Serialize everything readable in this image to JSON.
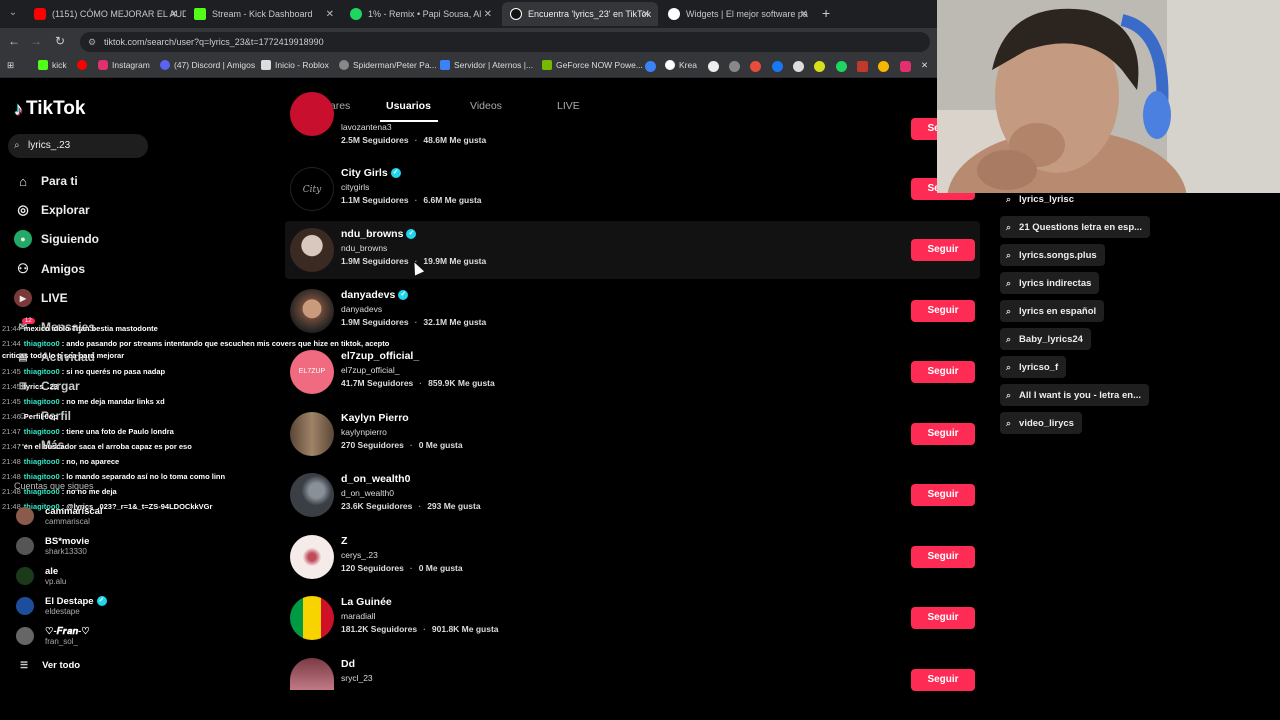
{
  "browser": {
    "tabs": [
      {
        "title": "(1151) CÓMO MEJORAR EL AUD",
        "favicon_color": "#ff0000"
      },
      {
        "title": "Stream - Kick Dashboard",
        "favicon_color": "#53fc18"
      },
      {
        "title": "1% - Remix • Papi Sousa, Al",
        "favicon_color": "#1ed760"
      },
      {
        "title": "Encuentra 'lyrics_23' en TikTok",
        "favicon_color": "#ffffff"
      },
      {
        "title": "Widgets | El mejor software pa",
        "favicon_color": "#ffffff"
      }
    ],
    "url": "tiktok.com/search/user?q=lyrics_23&t=1772419918990",
    "bookmarks": [
      {
        "label": "kick",
        "color": "#53fc18"
      },
      {
        "label": "Instagram",
        "color": "#e1306c"
      },
      {
        "label": "(47) Discord | Amigos",
        "color": "#5865f2"
      },
      {
        "label": "Inicio - Roblox",
        "color": "#dddddd"
      },
      {
        "label": "Spiderman/Peter Pa...",
        "color": "#888888"
      },
      {
        "label": "Servidor | Aternos |...",
        "color": "#3b82f6"
      },
      {
        "label": "GeForce NOW Powe...",
        "color": "#76b900"
      },
      {
        "label": "Krea",
        "color": "#ffffff"
      }
    ]
  },
  "tiktok": {
    "logo_text": "TikTok",
    "search_value": "lyrics_.23",
    "nav": [
      {
        "label": "Para ti",
        "icon": "home-icon"
      },
      {
        "label": "Explorar",
        "icon": "compass-icon"
      },
      {
        "label": "Siguiendo",
        "icon": "following-icon"
      },
      {
        "label": "Amigos",
        "icon": "friends-icon"
      },
      {
        "label": "LIVE",
        "icon": "live-icon"
      }
    ],
    "overlay_nav": [
      "Mensajes",
      "Actividad",
      "Cargar",
      "Perfil",
      "Más"
    ],
    "messages_badge": "12",
    "following_label": "Cuentas que sigues",
    "following_accounts": [
      {
        "name": "cammariscal",
        "handle": "cammariscal",
        "color": "#8a5a4a",
        "verified": false
      },
      {
        "name": "BS*movie",
        "handle": "shark13330",
        "color": "#555555",
        "verified": false
      },
      {
        "name": "ale",
        "handle": "vp.alu",
        "color": "#1a3a1a",
        "verified": false
      },
      {
        "name": "El Destape",
        "handle": "eldestape",
        "color": "#1d4e9c",
        "verified": true
      },
      {
        "name": "♡-𝑭𝒓𝒂𝒏-♡",
        "handle": "fran_sol_",
        "color": "#666666",
        "verified": false
      }
    ],
    "see_all": "Ver todo",
    "result_tabs": [
      "Populares",
      "Usuarios",
      "Videos",
      "LIVE"
    ],
    "active_tab": "Usuarios",
    "follow_label": "Seguir",
    "users": [
      {
        "name": "",
        "handle": "lavozantena3",
        "followers": "2.5M Seguidores",
        "likes": "48.6M Me gusta",
        "verified": false,
        "color": "#c8102e"
      },
      {
        "name": "City Girls",
        "handle": "citygirls",
        "followers": "1.1M Seguidores",
        "likes": "6.6M Me gusta",
        "verified": true,
        "color": "#000000"
      },
      {
        "name": "ndu_browns",
        "handle": "ndu_browns",
        "followers": "1.9M Seguidores",
        "likes": "19.9M Me gusta",
        "verified": true,
        "color": "#3b2a22"
      },
      {
        "name": "danyadevs",
        "handle": "danyadevs",
        "followers": "1.9M Seguidores",
        "likes": "32.1M Me gusta",
        "verified": true,
        "color": "#6d4a3a"
      },
      {
        "name": "el7zup_official_",
        "handle": "el7zup_official_",
        "followers": "41.7M Seguidores",
        "likes": "859.9K Me gusta",
        "verified": false,
        "color": "#f06a80"
      },
      {
        "name": "Kaylyn Pierro",
        "handle": "kaylynpierro",
        "followers": "270 Seguidores",
        "likes": "0 Me gusta",
        "verified": false,
        "color": "#7a6650"
      },
      {
        "name": "d_on_wealth0",
        "handle": "d_on_wealth0",
        "followers": "23.6K Seguidores",
        "likes": "293 Me gusta",
        "verified": false,
        "color": "#3a3f46"
      },
      {
        "name": "Z",
        "handle": "cerys_.23",
        "followers": "120 Seguidores",
        "likes": "0 Me gusta",
        "verified": false,
        "color": "#e8d4d0"
      },
      {
        "name": "La Guinée",
        "handle": "maradiall",
        "followers": "181.2K Seguidores",
        "likes": "901.8K Me gusta",
        "verified": false,
        "color": "#f7d400"
      },
      {
        "name": "Dd",
        "handle": "srycl_23",
        "followers": "",
        "likes": "",
        "verified": false,
        "color": "#7a3a45"
      }
    ],
    "suggestions": [
      "lyrics_lyrisc",
      "21 Questions letra en esp...",
      "lyrics.songs.plus",
      "lyrics indirectas",
      "lyrics en español",
      "Baby_lyrics24",
      "lyricso_f",
      "All I want is you - letra en...",
      "video_lirycs"
    ]
  },
  "chat": [
    {
      "time": "21:44",
      "user": "",
      "text": "mexico idolo Titan bestia mastodonte"
    },
    {
      "time": "21:44",
      "user": "thiagitoo0",
      "text": "ando pasando por streams intentando que escuchen mis covers que hize en tiktok, acepto"
    },
    {
      "time": "",
      "user": "",
      "text": "criticas todo lo q sea para mejorar"
    },
    {
      "time": "21:45",
      "user": "thiagitoo0",
      "text": "si no querés no pasa nadap"
    },
    {
      "time": "21:45",
      "user": "",
      "text": "lyrics_.23"
    },
    {
      "time": "21:45",
      "user": "thiagitoo0",
      "text": "no me deja mandar links xd"
    },
    {
      "time": "21:46",
      "user": "",
      "text": "Perfil 0op"
    },
    {
      "time": "21:47",
      "user": "thiagitoo0",
      "text": "tiene una foto de Paulo londra"
    },
    {
      "time": "21:47",
      "user": "",
      "text": "en el buscador saca el arroba capaz es por eso"
    },
    {
      "time": "21:48",
      "user": "thiagitoo0",
      "text": "no, no aparece"
    },
    {
      "time": "21:48",
      "user": "thiagitoo0",
      "text": "lo mando separado así no lo toma como linn"
    },
    {
      "time": "21:48",
      "user": "thiagitoo0",
      "text": "no no me deja"
    },
    {
      "time": "21:48",
      "user": "thiagitoo0",
      "text": "@lyrics_.023?_r=1&_t=ZS-94LDOCkkVGr"
    }
  ]
}
